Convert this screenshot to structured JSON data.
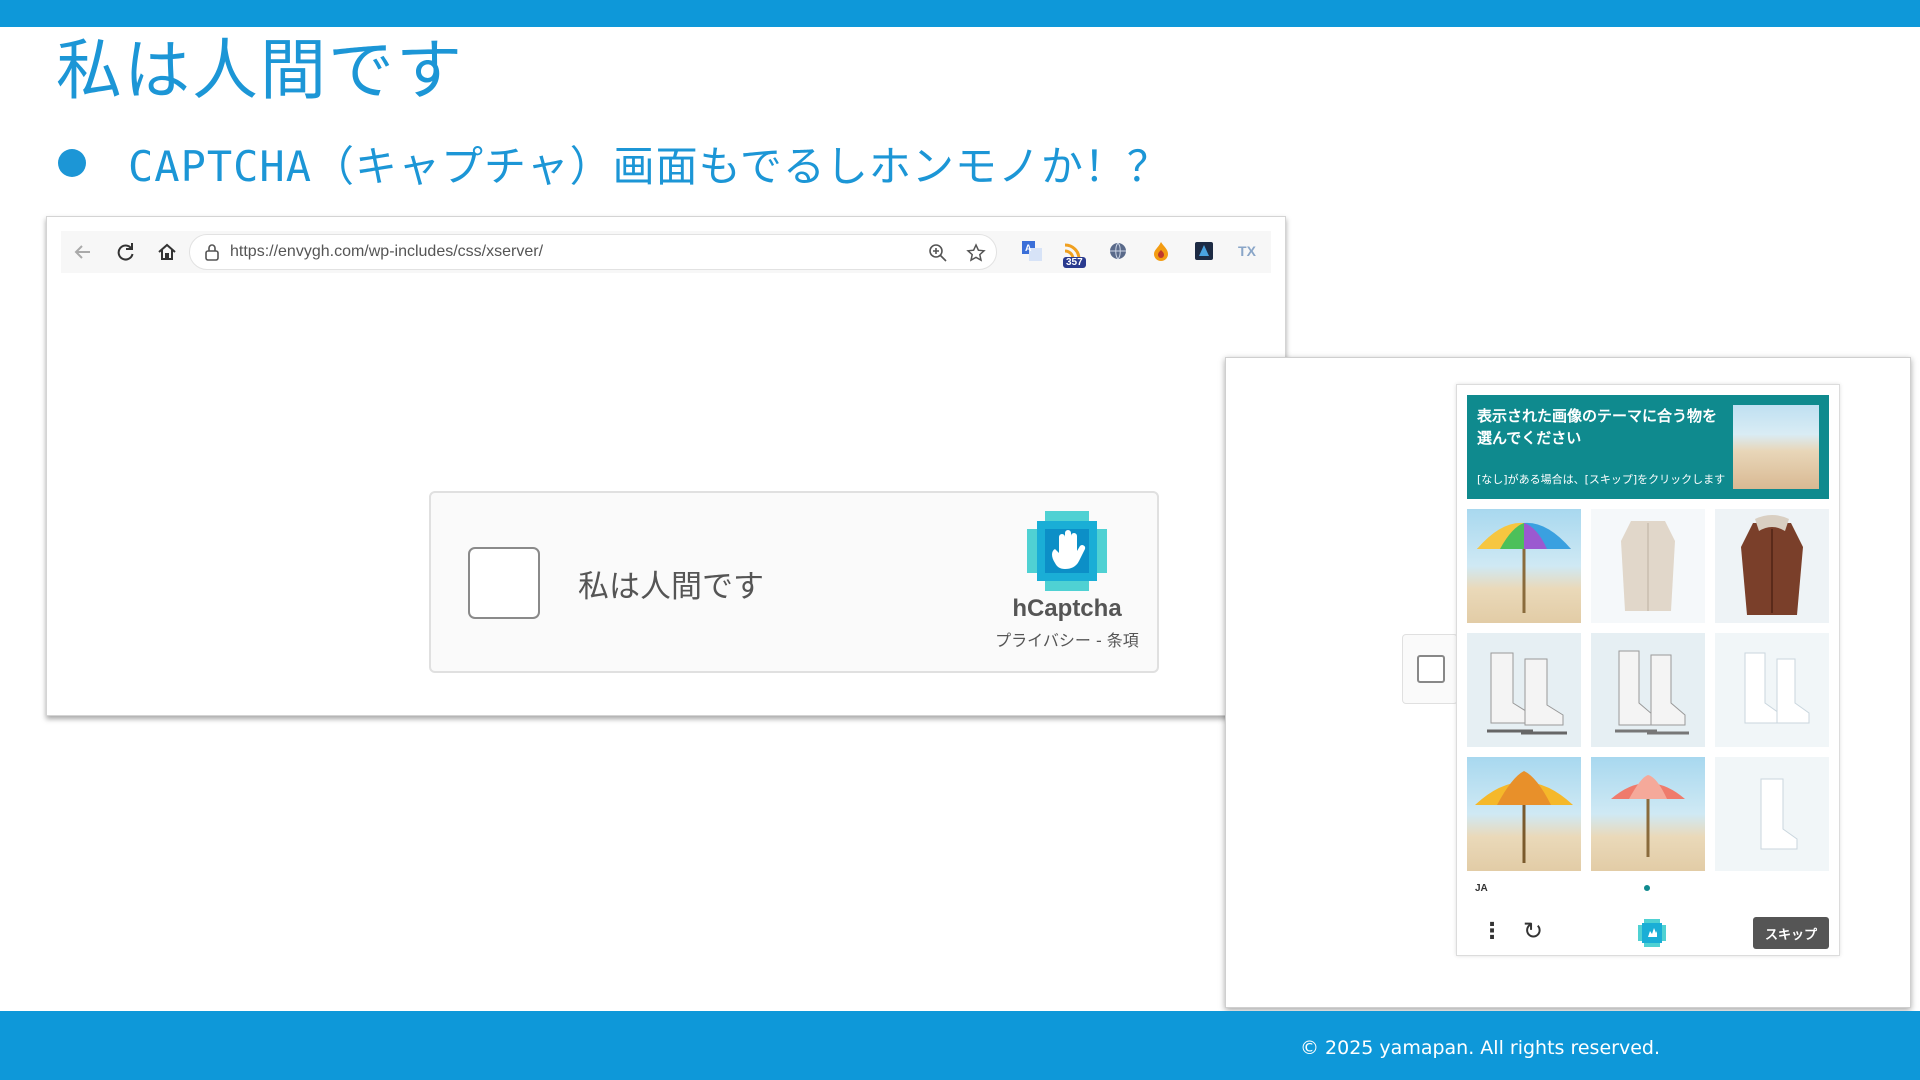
{
  "slide": {
    "title": "私は人間です",
    "bullet": "CAPTCHA（キャプチャ）画面もでるしホンモノか！？",
    "copyright": "© 2025 yamapan. All rights reserved."
  },
  "browser": {
    "url": "https://envygh.com/wp-includes/css/xserver/",
    "icons": [
      "back-icon",
      "reload-icon",
      "home-icon",
      "lock-icon",
      "zoom-icon",
      "star-icon"
    ],
    "extensions": [
      {
        "name": "translate-extension-icon"
      },
      {
        "name": "rss-extension-icon",
        "badge": "357"
      },
      {
        "name": "globe-extension-icon"
      },
      {
        "name": "flame-extension-icon"
      },
      {
        "name": "dark-extension-icon"
      },
      {
        "name": "text-extension-icon",
        "label": "TX"
      }
    ]
  },
  "captcha_widget": {
    "checkbox_label": "私は人間です",
    "brand": "hCaptcha",
    "links": "プライバシー - 条項"
  },
  "challenge": {
    "prompt_main": "表示された画像のテーマに合う物を選んでください",
    "prompt_sub": "[なし]がある場合は、[スキップ]をクリックします",
    "tiles": [
      {
        "name": "tile-rainbow-umbrella",
        "subject": "umbrella"
      },
      {
        "name": "tile-coat-faded",
        "subject": "coat"
      },
      {
        "name": "tile-fur-coat",
        "subject": "coat"
      },
      {
        "name": "tile-skates-1",
        "subject": "skates"
      },
      {
        "name": "tile-skates-2",
        "subject": "skates"
      },
      {
        "name": "tile-skates-faded",
        "subject": "skates"
      },
      {
        "name": "tile-yellow-umbrella",
        "subject": "umbrella"
      },
      {
        "name": "tile-pink-umbrella",
        "subject": "umbrella"
      },
      {
        "name": "tile-skate-faded",
        "subject": "skates"
      }
    ],
    "language": "JA",
    "skip_label": "スキップ"
  },
  "colors": {
    "brand_blue": "#0e98d9",
    "title_blue": "#1c96d6",
    "prompt_teal": "#0f8a8e"
  }
}
